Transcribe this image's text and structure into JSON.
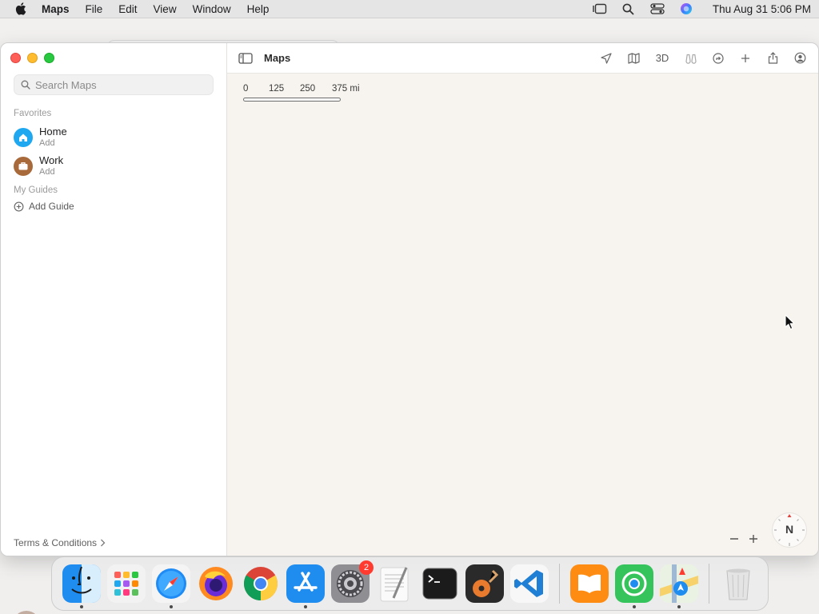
{
  "menubar": {
    "app_name": "Maps",
    "items": [
      "File",
      "Edit",
      "View",
      "Window",
      "Help"
    ],
    "clock": "Thu Aug 31  5:06 PM"
  },
  "window": {
    "title": "Maps",
    "search_placeholder": "Search Maps",
    "sections": {
      "favorites": "Favorites",
      "my_guides": "My Guides"
    },
    "favorites": [
      {
        "name": "Home",
        "sub": "Add",
        "icon": "house-icon",
        "color": "#1fa8f0"
      },
      {
        "name": "Work",
        "sub": "Add",
        "icon": "briefcase-icon",
        "color": "#a86a3a"
      }
    ],
    "add_guide": "Add Guide",
    "terms": "Terms & Conditions",
    "toolbar_3d": "3D",
    "scale": {
      "labels": [
        "0",
        "125",
        "250",
        "375 mi"
      ]
    },
    "compass": "N"
  },
  "dock": {
    "apps": [
      {
        "name": "Finder",
        "running": true
      },
      {
        "name": "Launchpad",
        "running": false
      },
      {
        "name": "Safari",
        "running": true
      },
      {
        "name": "Firefox",
        "running": false
      },
      {
        "name": "Chrome",
        "running": false
      },
      {
        "name": "App Store",
        "running": true
      },
      {
        "name": "System Settings",
        "running": false,
        "badge": "2"
      },
      {
        "name": "TextEdit",
        "running": false
      },
      {
        "name": "Terminal",
        "running": false
      },
      {
        "name": "GarageBand",
        "running": false
      },
      {
        "name": "Visual Studio Code",
        "running": false
      },
      {
        "name": "Books",
        "running": false
      },
      {
        "name": "Find My",
        "running": true
      },
      {
        "name": "Maps",
        "running": true
      },
      {
        "name": "Trash",
        "running": false
      }
    ]
  },
  "colors": {
    "accent": "#1fa8f0",
    "badge": "#ff3b30"
  }
}
